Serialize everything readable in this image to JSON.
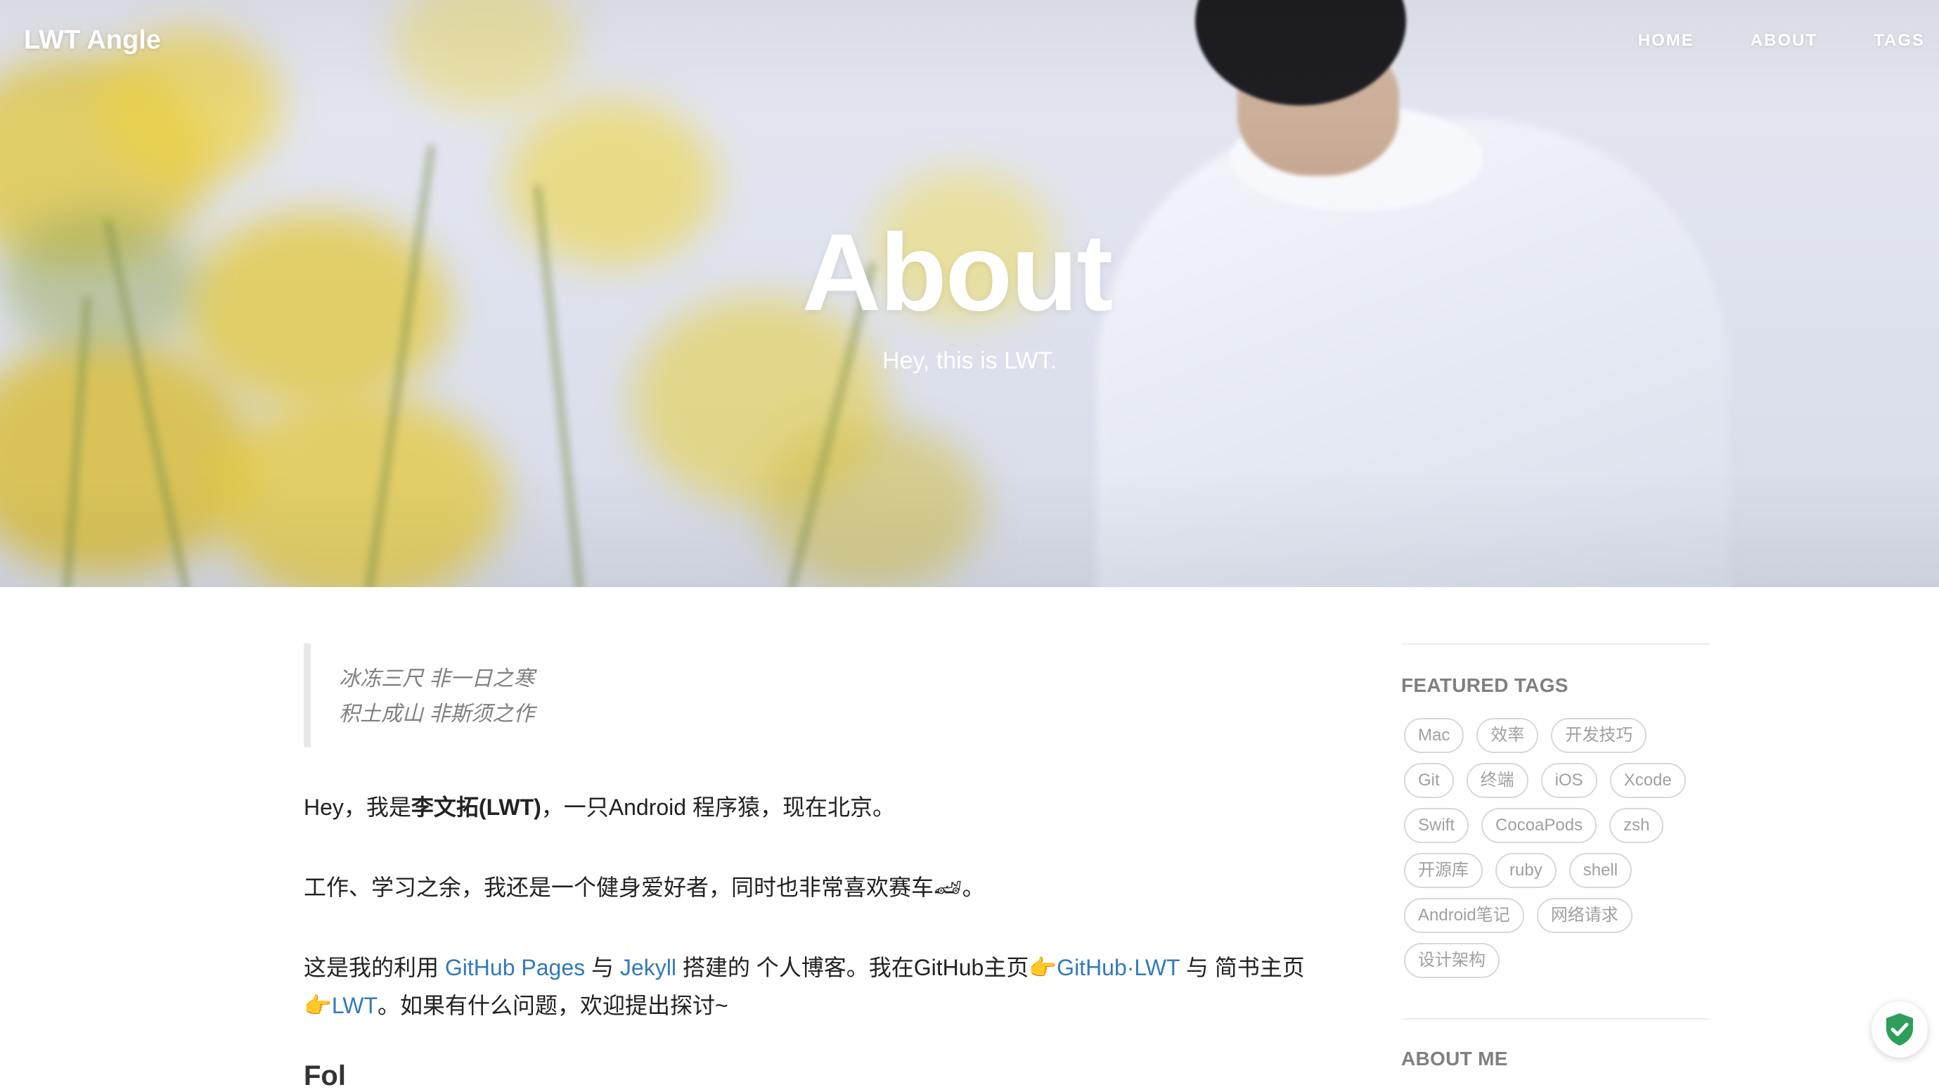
{
  "navbar": {
    "brand": "LWT Angle",
    "links": [
      "HOME",
      "ABOUT",
      "TAGS"
    ]
  },
  "hero": {
    "title": "About",
    "subtitle": "Hey, this is LWT."
  },
  "post": {
    "quote": [
      "冰冻三尺 非一日之寒",
      "积土成山 非斯须之作"
    ],
    "intro_pre": "Hey，我是",
    "intro_bold": "李文拓(LWT)",
    "intro_post": "，一只Android 程序猿，现在北京。",
    "hobby": "工作、学习之余，我还是一个健身爱好者，同时也非常喜欢赛车🏎。",
    "blog_1": "这是我的利用 ",
    "link_github_pages": "GitHub Pages",
    "blog_2": " 与 ",
    "link_jekyll": "Jekyll",
    "blog_3": " 搭建的 个人博客。我在GitHub主页👉",
    "link_github_lwt": "GitHub·LWT",
    "blog_4": " 与 简书主页",
    "blog_5": "👉",
    "link_lwt": "LWT",
    "blog_6": "。如果有什么问题，欢迎提出探讨~",
    "next_heading_partial": "Fol"
  },
  "sidebar": {
    "featured_tags_heading": "FEATURED TAGS",
    "tags": [
      "Mac",
      "效率",
      "开发技巧",
      "Git",
      "终端",
      "iOS",
      "Xcode",
      "Swift",
      "CocoaPods",
      "zsh",
      "开源库",
      "ruby",
      "shell",
      "Android笔记",
      "网络请求",
      "设计架构"
    ],
    "about_me_heading": "ABOUT ME"
  },
  "floating": {
    "icon": "shield-check-icon",
    "color": "#2e9e5b"
  }
}
